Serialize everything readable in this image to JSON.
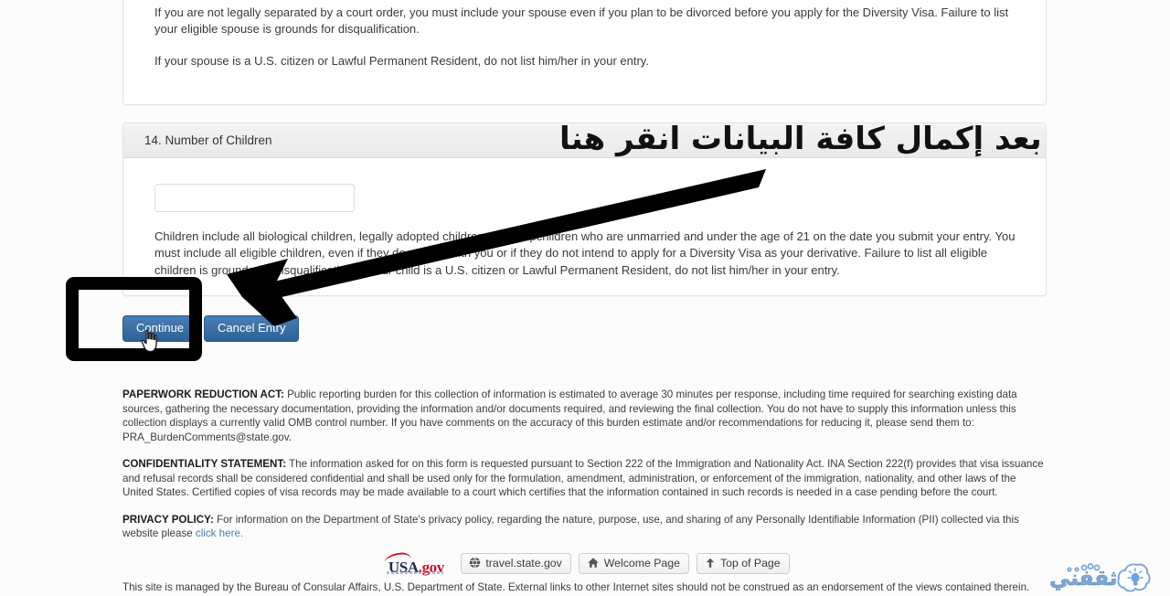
{
  "spouse_card": {
    "paragraphs": [
      "If you are not legally separated by a court order, you must include your spouse even if you plan to be divorced before you apply for the Diversity Visa. Failure to list your eligible spouse is grounds for disqualification.",
      "If your spouse is a U.S. citizen or Lawful Permanent Resident, do not list him/her in your entry."
    ]
  },
  "children_card": {
    "header": "14. Number of Children",
    "input_value": "",
    "input_placeholder": "",
    "paragraph": "Children include all biological children, legally adopted children, and stepchildren who are unmarried and under the age of 21 on the date you submit your entry. You must include all eligible children, even if they do not live with you or if they do not intend to apply for a Diversity Visa as your derivative. Failure to list all eligible children is grounds for disqualification. If your child is a U.S. citizen or Lawful Permanent Resident, do not list him/her in your entry."
  },
  "buttons": {
    "continue": "Continue",
    "cancel": "Cancel Entry"
  },
  "annotation": {
    "arabic_text": "بعد إكمال كافة البيانات انقر هنا",
    "arrow_color": "#000000",
    "highlight_color": "#000000"
  },
  "legal": {
    "paperwork_label": "PAPERWORK REDUCTION ACT:",
    "paperwork_text": " Public reporting burden for this collection of information is estimated to average 30 minutes per response, including time required for searching existing data sources, gathering the necessary documentation, providing the information and/or documents required, and reviewing the final collection. You do not have to supply this information unless this collection displays a currently valid OMB control number. If you have comments on the accuracy of this burden estimate and/or recommendations for reducing it, please send them to: PRA_BurdenComments@state.gov.",
    "confidentiality_label": "CONFIDENTIALITY STATEMENT:",
    "confidentiality_text": " The information asked for on this form is requested pursuant to Section 222 of the Immigration and Nationality Act. INA Section 222(f) provides that visa issuance and refusal records shall be considered confidential and shall be used only for the formulation, amendment, administration, or enforcement of the immigration, nationality, and other laws of the United States. Certified copies of visa records may be made available to a court which certifies that the information contained in such records is needed in a case pending before the court.",
    "privacy_label": "PRIVACY POLICY:",
    "privacy_text": " For information on the Department of State's privacy policy, regarding the nature, purpose, use, and sharing of any Personally Identifiable Information (PII) collected via this website please ",
    "privacy_link": "click here."
  },
  "bottom_nav": {
    "logo_usa": "USA",
    "logo_gov": ".gov",
    "items": [
      {
        "label": "travel.state.gov",
        "icon": "globe-icon"
      },
      {
        "label": "Welcome Page",
        "icon": "home-icon"
      },
      {
        "label": "Top of Page",
        "icon": "arrow-up-icon"
      }
    ]
  },
  "site_note": "This site is managed by the Bureau of Consular Affairs, U.S. Department of State. External links to other Internet sites should not be construed as an endorsement of the views contained therein.",
  "watermark": {
    "text": "ثقفني",
    "color": "#7fa8d4"
  }
}
